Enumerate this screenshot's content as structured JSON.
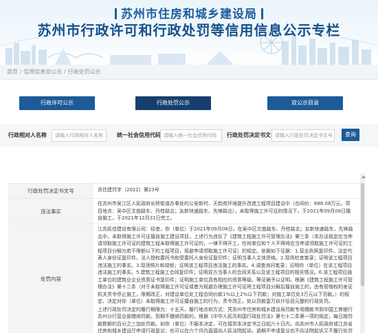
{
  "header": {
    "org_name": "苏州市住房和城乡建设局",
    "title": "苏州市行政许可和行政处罚等信用信息公示专栏"
  },
  "breadcrumb": [
    "首页",
    "信用信息双公示",
    "行政处罚公示"
  ],
  "tabs": [
    {
      "label": "行政许可公示"
    },
    {
      "label": "行政处罚公示"
    },
    {
      "label": "双公示目录"
    }
  ],
  "search": {
    "fields": [
      {
        "label": "行政相对人名称",
        "placeholder": "请输入行政相对人名称"
      },
      {
        "label": "统一社会信用代码",
        "placeholder": "请输入统一社会信用代码"
      },
      {
        "label": "行政处罚决定书文号",
        "placeholder": "请输入行政处罚决定书文号"
      }
    ],
    "button_label": "查询"
  },
  "detail": {
    "rows": [
      {
        "key": "行政处罚决定书文号",
        "value": "苏住建罚字〔2022〕第23号"
      },
      {
        "key": "违法事实",
        "paragraphs": [
          "在苏州市吴江区人民政府长桥街道办事处的公安新村、天韵苑环境提升改造工程项目建设中（合同价：688.08万元，项目地点：吴中区文曲路东、丹桂路北；友新快速路东、先锋路北），未取得施工许可证的情况下，于2021年09月08日擅自施工，于2021年12月31日完工。"
        ]
      },
      {
        "key": "处罚内容",
        "paragraphs": [
          "江苏民佳建设有限公司：经查，你（单位）于2021年09月08日，在吴中区文曲路东、丹桂路北；友新快速路东，先锋路北中，未取得施工许可证擅自施工建设项目，上述行为违反了《建筑工程施工许可管理办法》第三条（本办法规定应当申请领取施工许可证的建筑工程未取得施工许可证的，一律不得开工，任何单位和个人不得将应当申请领取施工许可证的工程项目分解为若干限额以下的工程项目，规避申请领取施工许可证）的规定。依据如下证据：1.营业执照复印件、法定代表人身份证复印件、法人授权委托书和受委托人身份证复印件；证明当事人主体资格。2.现场检查笔录；证明该工程项目违法施工的事实。3.现场照片和视频；证明该工程项目违法施工的事实。4.调查询问笔录；证明你（单位）在该工程项目违法施工的事实。5.建筑工程施工合同复印件；证明双方当事人的合同关系以及该工程项目的相关情况。6.该工程项目施工单位的建筑业企业资质证书复印件；证明施工单位具有相应的资质等级。等证据予以证明。根据《建筑工程施工许可管理办法》第十二条（对于未取得施工许可证或者为规避办理施工许可证将工程项目分解后擅自施工的，由有管辖权的发证机关责令停止施工，限期改正，对建设单位处工程合同价款1%以上2%以下罚款；对施工单位处3万元以下罚款。）的规定，决定对你（单位）未取得施工许可证擅自施工的行为，责令改正，处以罚款壹万玖仟伍佰元整的行政处罚。",
          "上述行政处罚决定的履行期限为：十五天，履行地点和方式：凭苏州市住房和城乡建设局罚款专用缴款书到中国工商银行苏州分行营业部缴纳罚款。到期不缴纳罚款的，根据《中华人民共和国行政处罚法》第七十二条第一项的规定，每日按罚款数额的百分之三加处罚款。如你（单位）不服本决定，可在接到本决定书之日起六十日内，向苏州市人民政府或江苏省住房和城乡建设厅申请行政复议；也可以在六个月内直接向人民法院起诉。逾期不申请复议也不向法院起诉又不履行处罚决定的，本机关将依法申请人民法院强制执行。行政复议和行政诉讼期间，本决定不停止执行。"
        ]
      }
    ]
  },
  "colors": {
    "brand_blue": "#1d5a98",
    "tab_active": "#163f6e",
    "title_blue": "#17508c"
  }
}
